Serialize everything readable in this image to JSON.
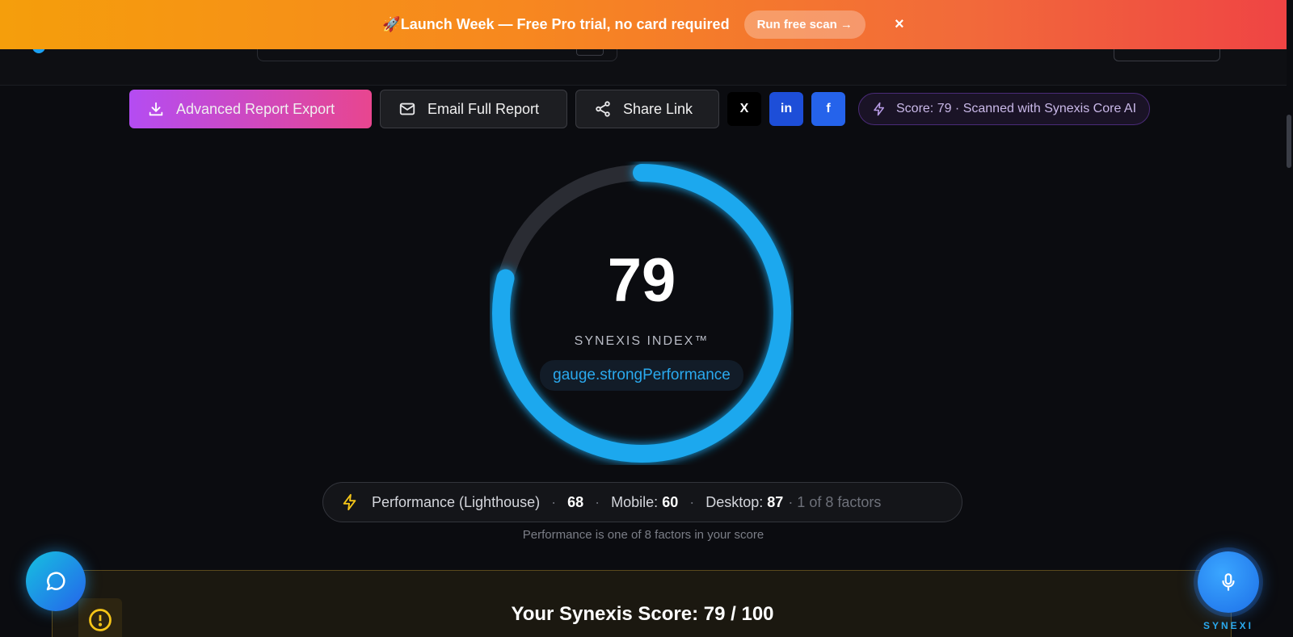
{
  "banner": {
    "text": "🚀Launch Week — Free Pro trial, no card required",
    "cta": "Run free scan →",
    "close": "×"
  },
  "toolbar": {
    "export_label": "Advanced Report Export",
    "email_label": "Email Full Report",
    "share_label": "Share Link",
    "social_x": "X",
    "social_linkedin": "in",
    "social_facebook": "f",
    "score_pill": "Score: 79 · Scanned with Synexis Core AI"
  },
  "gauge": {
    "value": "79",
    "score": 79,
    "max": 100,
    "label": "SYNEXIS INDEX™",
    "status": "gauge.strongPerformance",
    "color": "#1aa8ee"
  },
  "performance": {
    "name": "Performance (Lighthouse)",
    "score": "68",
    "mobile_label": "Mobile:",
    "mobile_value": "60",
    "desktop_label": "Desktop:",
    "desktop_value": "87",
    "factor_note": "· 1 of 8 factors",
    "sep": "·",
    "footnote": "Performance is one of 8 factors in your score"
  },
  "score_card": {
    "title": "Your Synexis Score: 79 / 100"
  },
  "assistant": {
    "label": "SYNEXI"
  },
  "colors": {
    "accent": "#1aa8ee",
    "export_gradient_start": "#b44cf2",
    "export_gradient_end": "#e8468f",
    "warning": "#f5c518"
  }
}
